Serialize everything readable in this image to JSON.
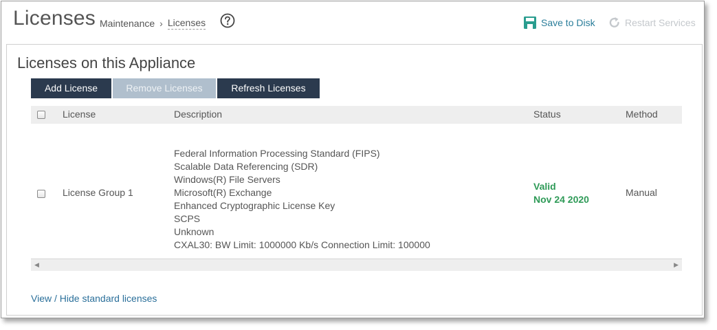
{
  "header": {
    "title": "Licenses",
    "breadcrumb": {
      "parent": "Maintenance",
      "separator": "›",
      "current": "Licenses"
    },
    "help_icon": "help-circle-icon",
    "save_label": "Save to Disk",
    "restart_label": "Restart Services"
  },
  "panel": {
    "title": "Licenses on this Appliance",
    "toolbar": {
      "add_label": "Add License",
      "remove_label": "Remove Licenses",
      "refresh_label": "Refresh Licenses"
    },
    "table": {
      "columns": [
        "License",
        "Description",
        "Status",
        "Method"
      ],
      "rows": [
        {
          "license": "License Group 1",
          "description": [
            "Federal Information Processing Standard (FIPS)",
            "Scalable Data Referencing (SDR)",
            "Windows(R) File Servers",
            "Microsoft(R) Exchange",
            "Enhanced Cryptographic License Key",
            "SCPS",
            "Unknown",
            "CXAL30: BW Limit: 1000000 Kb/s Connection Limit: 100000"
          ],
          "status": [
            "Valid",
            "Nov 24 2020"
          ],
          "method": "Manual"
        }
      ]
    },
    "view_link": "View / Hide standard licenses"
  },
  "colors": {
    "button_dark": "#2b3a4e",
    "button_disabled": "#b0bfcd",
    "status_valid": "#2e9a57",
    "link": "#2a6f9a",
    "save_icon": "#2a9d8f"
  }
}
